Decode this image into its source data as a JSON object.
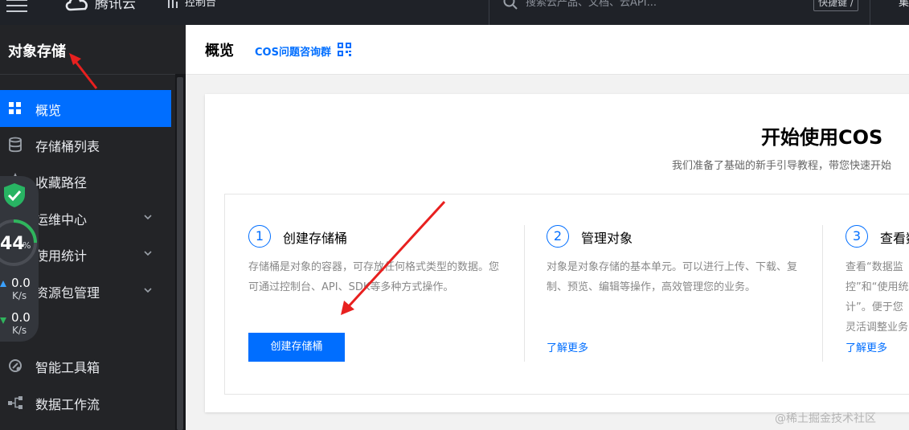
{
  "topbar": {
    "logo_text": "腾讯云",
    "console_label": "控制台",
    "search_placeholder": "搜索云产品、文档、云API...",
    "shortcut_label": "快捷键 /",
    "right_text": "集"
  },
  "sidebar": {
    "title": "对象存储",
    "items": [
      {
        "label": "概览",
        "icon": "grid-icon",
        "active": true
      },
      {
        "label": "存储桶列表",
        "icon": "database-icon"
      },
      {
        "label": "收藏路径",
        "icon": "star-icon"
      },
      {
        "label": "运维中心",
        "icon": "monitor-icon",
        "expandable": true
      },
      {
        "label": "使用统计",
        "icon": "chart-icon",
        "expandable": true
      },
      {
        "label": "资源包管理",
        "icon": "package-icon",
        "expandable": true
      },
      {
        "label": "智能工具箱",
        "icon": "toolbox-icon"
      },
      {
        "label": "数据工作流",
        "icon": "workflow-icon"
      }
    ]
  },
  "speed_widget": {
    "percent": "44",
    "percent_sign": "%",
    "upload_speed": "0.0",
    "upload_unit": "K/s",
    "download_speed": "0.0",
    "download_unit": "K/s"
  },
  "header": {
    "title": "概览",
    "group_link": "COS问题咨询群"
  },
  "intro": {
    "title": "开始使用COS",
    "subtitle": "我们准备了基础的新手引导教程，带您快速开始"
  },
  "steps": [
    {
      "number": "1",
      "title": "创建存储桶",
      "description": "存储桶是对象的容器，可存放任何格式类型的数据。您可通过控制台、API、SDK等多种方式操作。",
      "action": "创建存储桶"
    },
    {
      "number": "2",
      "title": "管理对象",
      "description": "对象是对象存储的基本单元。可以进行上传、下载、复制、预览、编辑等操作，高效管理您的业务。",
      "link": "了解更多"
    },
    {
      "number": "3",
      "title": "查看数据",
      "description": "查看“数据监控”和“使用统计”。便于您灵活调整业务",
      "link": "了解更多"
    }
  ],
  "watermark": "@稀土掘金技术社区",
  "colors": {
    "accent": "#006eff",
    "sidebar_bg": "#232427",
    "topbar_bg": "#1f2228",
    "annotation_arrow": "#e8201f"
  }
}
